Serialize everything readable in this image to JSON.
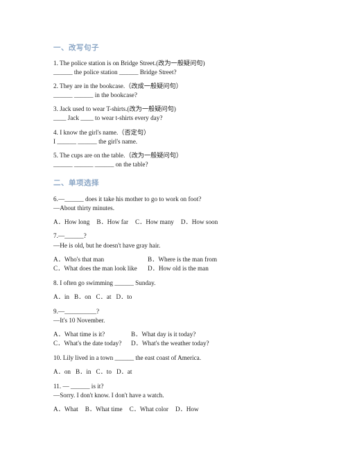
{
  "document": {
    "sections": [
      {
        "id": "section-one",
        "heading": "一、改写句子",
        "questions": [
          {
            "prompt": "1. The police station is on Bridge Street.(改为一般疑问句)",
            "answer_line": "______ the police station ______ Bridge Street?"
          },
          {
            "prompt": "2. They are in the bookcase.（改成一般疑问句）",
            "answer_line": "______ ______ in the bookcase?"
          },
          {
            "prompt": "3. Jack used to wear T-shirts.(改为一般疑问句)",
            "answer_line": "____ Jack ____ to wear t-shirts every day?"
          },
          {
            "prompt": "4. I know the girl's name.（否定句）",
            "answer_line": "I ______ ______ the girl's name."
          },
          {
            "prompt": "5. The cups are on the table.（改为一般疑问句）",
            "answer_line": "______ ______ ______ on the table?"
          }
        ]
      },
      {
        "id": "section-two",
        "heading": "二、单项选择",
        "questions": [
          {
            "number": "6",
            "stem": "6.—______ does it take his mother to go to work on foot?",
            "reply": "—About thirty minutes.",
            "layout": "inline",
            "options": [
              "A．How long",
              "B．How far",
              "C．How many",
              "D．How soon"
            ]
          },
          {
            "number": "7",
            "stem": "7.—______?",
            "reply": "—He is old, but he doesn't have gray hair.",
            "layout": "grid-wide",
            "options": [
              "A．Who's that man",
              "B．Where is the man from",
              "C．What does the man look like",
              "D．How old is the man"
            ]
          },
          {
            "number": "8",
            "stem": "8. I often go swimming ______ Sunday.",
            "reply": "",
            "layout": "inline",
            "options": [
              "A．in",
              "B．on",
              "C．at",
              "D．to"
            ]
          },
          {
            "number": "9",
            "stem": "9.—__________?",
            "reply": "—It's 10 November.",
            "layout": "grid-narrow",
            "options": [
              "A．What time is it?",
              "B．What day is it today?",
              "C．What's the date today?",
              "D．What's the weather today?"
            ]
          },
          {
            "number": "10",
            "stem": "10. Lily lived in a town ______ the east coast of America.",
            "reply": "",
            "layout": "inline",
            "options": [
              "A．on",
              "B．in",
              "C．to",
              "D．at"
            ]
          },
          {
            "number": "11",
            "stem": "11. — ______ is it?",
            "reply": "—Sorry. I don't know. I don't have a watch.",
            "layout": "inline",
            "options": [
              "A．What",
              "B．What time",
              "C．What color",
              "D．How"
            ]
          }
        ]
      }
    ]
  },
  "colors": {
    "heading": "#8ca7c6",
    "body_text": "#1a1a1a",
    "page_background": "#ffffff"
  }
}
